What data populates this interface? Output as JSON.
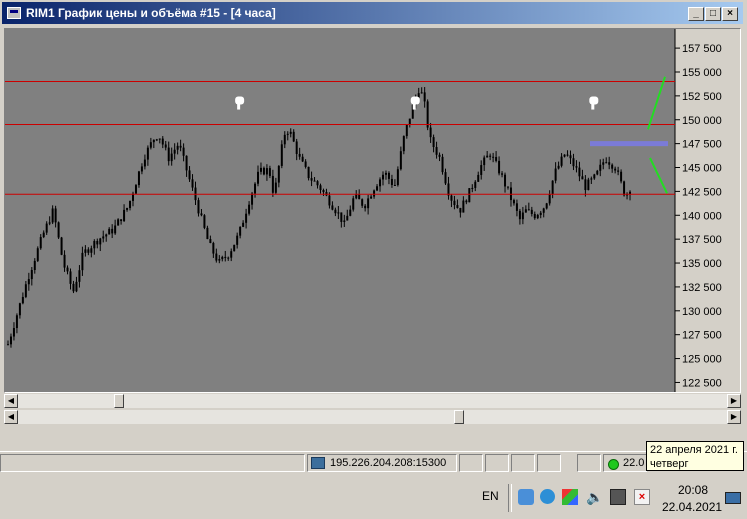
{
  "window": {
    "title": "RIM1 График цены и объёма #15 - [4 часа]"
  },
  "chart_data": {
    "type": "candlestick",
    "ylim": [
      121500,
      159500
    ],
    "y_ticks": [
      "157 500",
      "155 000",
      "152 500",
      "150 000",
      "147 500",
      "145 000",
      "142 500",
      "140 000",
      "137 500",
      "135 000",
      "132 500",
      "130 000",
      "127 500",
      "125 000",
      "122 500"
    ],
    "horizontal_levels": [
      154000,
      149500,
      142200
    ],
    "highlight_level": 147500,
    "bars_count": 210,
    "close_path": [
      [
        0,
        126500
      ],
      [
        8,
        133500
      ],
      [
        14,
        138000
      ],
      [
        18,
        140500
      ],
      [
        22,
        135000
      ],
      [
        26,
        132000
      ],
      [
        30,
        136000
      ],
      [
        36,
        137500
      ],
      [
        42,
        138500
      ],
      [
        48,
        141000
      ],
      [
        54,
        146000
      ],
      [
        58,
        148000
      ],
      [
        60,
        148500
      ],
      [
        64,
        146000
      ],
      [
        68,
        147500
      ],
      [
        72,
        144000
      ],
      [
        76,
        140500
      ],
      [
        80,
        137000
      ],
      [
        84,
        135000
      ],
      [
        88,
        136000
      ],
      [
        92,
        138000
      ],
      [
        96,
        141500
      ],
      [
        100,
        144500
      ],
      [
        104,
        144800
      ],
      [
        106,
        142000
      ],
      [
        110,
        148500
      ],
      [
        112,
        149000
      ],
      [
        116,
        146000
      ],
      [
        120,
        144000
      ],
      [
        124,
        143000
      ],
      [
        128,
        141500
      ],
      [
        132,
        140000
      ],
      [
        134,
        139000
      ],
      [
        138,
        142000
      ],
      [
        142,
        141000
      ],
      [
        146,
        143000
      ],
      [
        150,
        144500
      ],
      [
        154,
        143000
      ],
      [
        158,
        148500
      ],
      [
        162,
        152000
      ],
      [
        164,
        153500
      ],
      [
        166,
        151500
      ],
      [
        168,
        148000
      ],
      [
        172,
        146000
      ],
      [
        176,
        142000
      ],
      [
        180,
        140500
      ],
      [
        184,
        142500
      ],
      [
        188,
        145000
      ],
      [
        192,
        146500
      ],
      [
        196,
        144500
      ],
      [
        200,
        142000
      ],
      [
        204,
        139500
      ],
      [
        206,
        140500
      ],
      [
        210,
        140000
      ],
      [
        214,
        141000
      ],
      [
        218,
        144500
      ],
      [
        222,
        146500
      ],
      [
        226,
        145000
      ],
      [
        230,
        143000
      ],
      [
        234,
        144000
      ],
      [
        238,
        146000
      ],
      [
        242,
        145000
      ],
      [
        246,
        142000
      ],
      [
        249,
        143500
      ]
    ],
    "marker_icon": "thumbs-up-icon",
    "marker_bars": [
      78,
      137,
      197
    ],
    "projection_colors": {
      "up": "#22dd22",
      "down": "#22dd22"
    },
    "colors": {
      "background": "#808080",
      "candle": "#000000",
      "level": "#cc0000",
      "highlight": "#7b7bd8",
      "grid_text": "#000000"
    }
  },
  "statusbar": {
    "server": "195.226.204.208:15300",
    "connection_time": "22.0"
  },
  "taskbar": {
    "lang": "EN",
    "time": "20:08",
    "date": "22.04.2021",
    "tooltip_line1": "22 апреля 2021 г.",
    "tooltip_line2": "четверг"
  }
}
